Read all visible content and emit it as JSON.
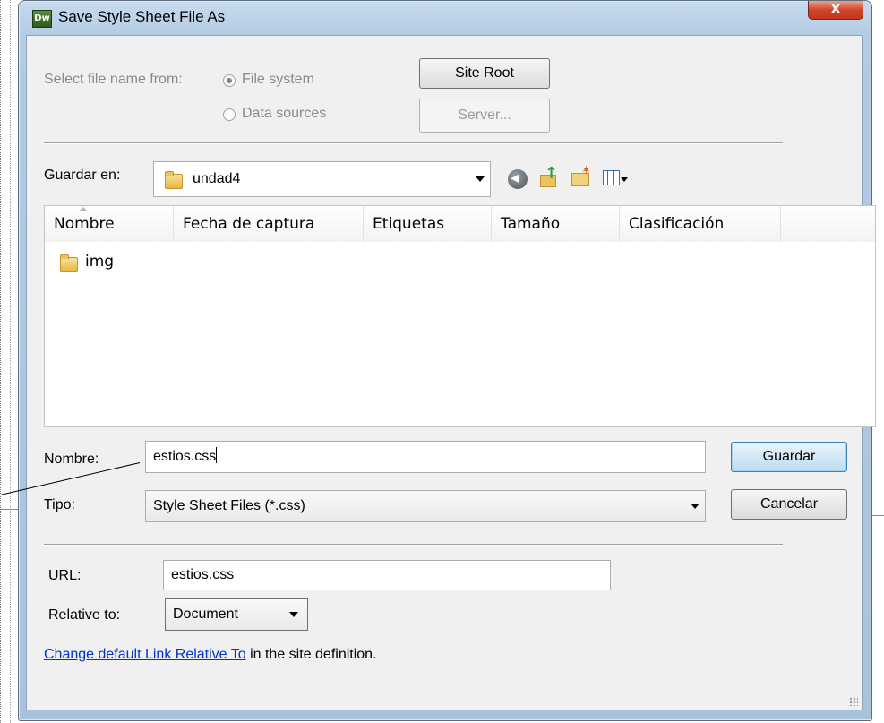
{
  "window": {
    "title": "Save Style Sheet File As",
    "app_icon": "Dw",
    "close_glyph": "X"
  },
  "source": {
    "label": "Select file name from:",
    "options": [
      "File system",
      "Data sources"
    ],
    "selected": "File system",
    "site_root_label": "Site Root",
    "server_label": "Server..."
  },
  "location": {
    "label": "Guardar en:",
    "value": "undad4"
  },
  "file_list": {
    "columns": [
      "Nombre",
      "Fecha de captura",
      "Etiquetas",
      "Tamaño",
      "Clasificación"
    ],
    "items": [
      {
        "name": "img",
        "type": "folder"
      }
    ]
  },
  "form": {
    "name_label": "Nombre:",
    "name_value": "estios.css",
    "type_label": "Tipo:",
    "type_value": "Style Sheet Files (*.css)",
    "save_label": "Guardar",
    "cancel_label": "Cancelar"
  },
  "url": {
    "label": "URL:",
    "value": "estios.css",
    "relative_label": "Relative to:",
    "relative_value": "Document"
  },
  "footer": {
    "link_text": "Change default Link Relative To",
    "suffix_text": " in the site definition."
  },
  "icons": {
    "toolbar": [
      "back-icon",
      "up-folder-icon",
      "new-folder-icon",
      "view-menu-icon"
    ]
  }
}
